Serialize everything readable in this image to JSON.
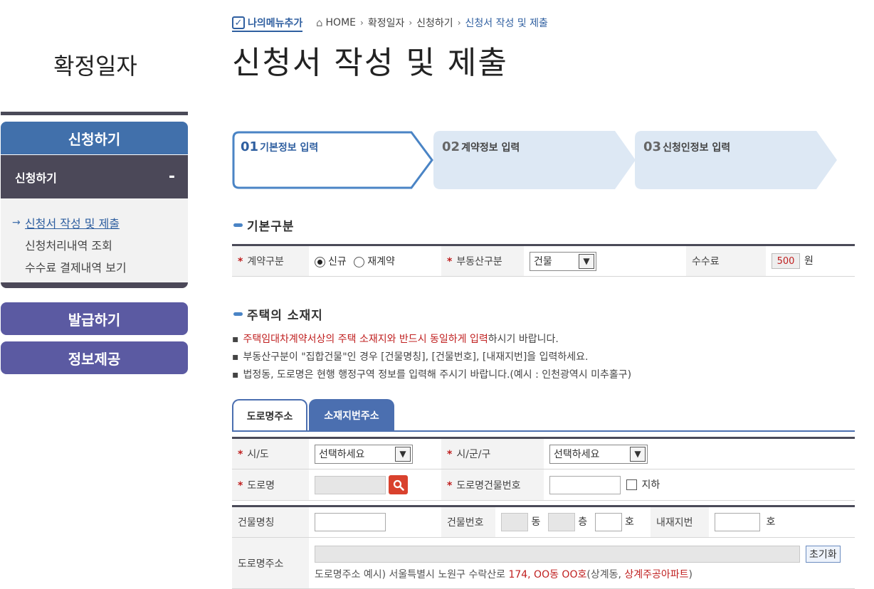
{
  "sidebar": {
    "title": "확정일자",
    "menu_apply": "신청하기",
    "sub_head": "신청하기",
    "sub_toggle": "-",
    "sub_items": [
      "신청서 작성 및 제출",
      "신청처리내역 조회",
      "수수료 결제내역 보기"
    ],
    "menu_issue": "발급하기",
    "menu_info": "정보제공"
  },
  "header": {
    "my_menu": "나의메뉴추가",
    "breadcrumb": [
      "HOME",
      "확정일자",
      "신청하기",
      "신청서 작성 및 제출"
    ],
    "page_title": "신청서 작성 및 제출"
  },
  "steps": [
    {
      "num": "01",
      "label": "기본정보 입력"
    },
    {
      "num": "02",
      "label": "계약정보 입력"
    },
    {
      "num": "03",
      "label": "신청인정보 입력"
    }
  ],
  "basic": {
    "section_title": "기본구분",
    "contract_label": "계약구분",
    "radio_new": "신규",
    "radio_renew": "재계약",
    "property_label": "부동산구분",
    "property_value": "건물",
    "fee_label": "수수료",
    "fee_value": "500",
    "fee_unit": "원"
  },
  "address": {
    "section_title": "주택의 소재지",
    "notice1_red": "주택임대차계약서상의 주택 소재지와 반드시 동일하게 입력",
    "notice1_rest": "하시기 바랍니다.",
    "notice2": "부동산구분이 \"집합건물\"인 경우 [건물명칭], [건물번호], [내재지번]을 입력하세요.",
    "notice3": "법정동, 도로명은 현행 행정구역 정보를 입력해 주시기 바랍니다.(예시 : 인천광역시 미추홀구)",
    "tab_road": "도로명주소",
    "tab_lot": "소재지번주소",
    "sido_label": "시/도",
    "sido_value": "선택하세요",
    "sigungu_label": "시/군/구",
    "sigungu_value": "선택하세요",
    "road_label": "도로명",
    "road_bldg_no_label": "도로명건물번호",
    "basement_label": "지하",
    "bldg_name_label": "건물명칭",
    "bldg_no_label": "건물번호",
    "dong_unit": "동",
    "floor_unit": "층",
    "ho_unit": "호",
    "inner_lot_label": "내재지번",
    "inner_ho_unit": "호",
    "road_addr_label": "도로명주소",
    "reset_button": "초기화",
    "example_prefix": "도로명주소 예시) 서울특별시 노원구 수락산로 ",
    "example_red1": "174, OO동 OO호",
    "example_mid": "(상계동, ",
    "example_red2": "상계주공아파트",
    "example_suffix": ")"
  },
  "colors": {
    "primary_blue": "#4170ab",
    "dark_gray": "#4b4858",
    "purple": "#5b5aa2",
    "required_red": "#c02020"
  }
}
